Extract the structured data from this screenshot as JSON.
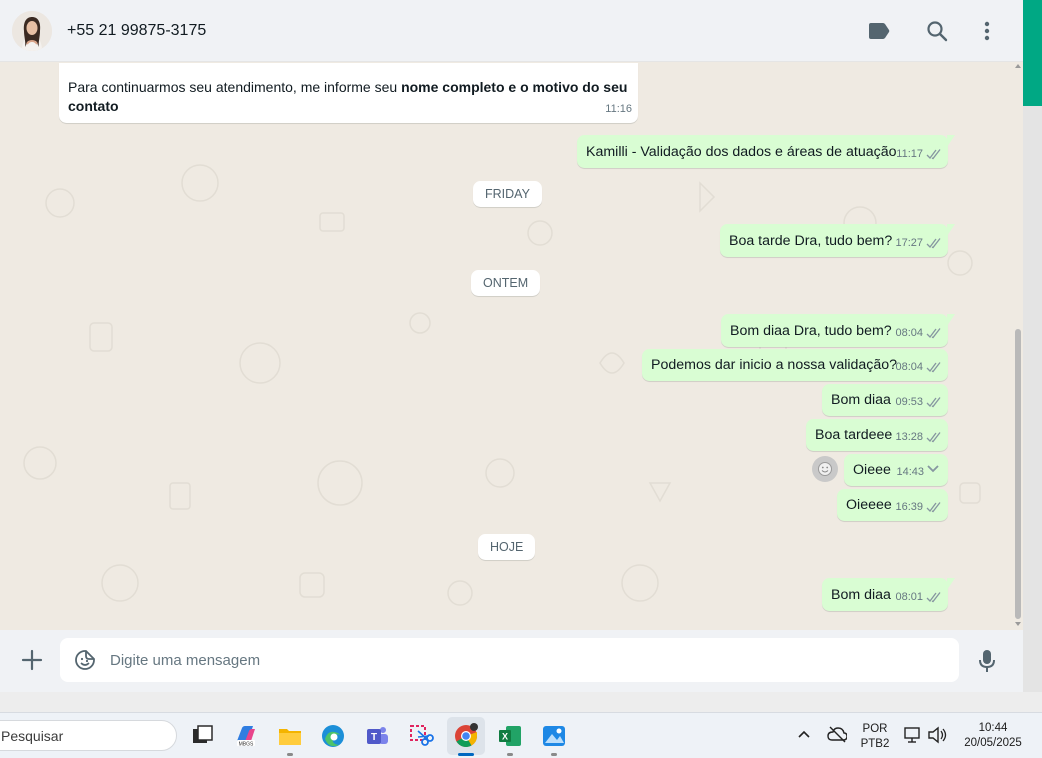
{
  "header": {
    "contact_name": "+55 21 99875-3175",
    "icons": [
      "label-icon",
      "search-icon",
      "kebab-menu-icon"
    ]
  },
  "messages": {
    "m0": {
      "text_plain": "Para continuarmos seu atendimento, me informe seu ",
      "text_bold_1": "nome completo e o motivo do seu",
      "text_bold_2": "contato",
      "time": "11:16",
      "direction": "in"
    },
    "m1": {
      "text": "Kamilli - Validação dos dados e áreas de atuação",
      "time": "11:17",
      "direction": "out"
    },
    "d1": "FRIDAY",
    "m2": {
      "text": "Boa tarde Dra, tudo bem?",
      "time": "17:27",
      "direction": "out"
    },
    "d2": "ONTEM",
    "m3": {
      "text": "Bom diaa Dra, tudo bem?",
      "time": "08:04",
      "direction": "out"
    },
    "m4": {
      "text": "Podemos dar inicio a nossa validação?",
      "time": "08:04",
      "direction": "out"
    },
    "m5": {
      "text": "Bom diaa",
      "time": "09:53",
      "direction": "out"
    },
    "m6": {
      "text": "Boa tardeee",
      "time": "13:28",
      "direction": "out"
    },
    "m7": {
      "text": "Oieee",
      "time": "14:43",
      "direction": "out"
    },
    "m8": {
      "text": "Oieeee",
      "time": "16:39",
      "direction": "out"
    },
    "d3": "HOJE",
    "m9": {
      "text": "Bom diaa",
      "time": "08:01",
      "direction": "out"
    }
  },
  "composer": {
    "placeholder": "Digite uma mensagem"
  },
  "taskbar": {
    "search_label": "Pesquisar",
    "lang_1": "POR",
    "lang_2": "PTB2",
    "clock_time": "10:44",
    "clock_date": "20/05/2025"
  },
  "colors": {
    "outgoing_bubble": "#d9fdd3",
    "incoming_bubble": "#ffffff",
    "chat_bg": "#efeae2",
    "accent": "#00a884",
    "tick_color": "#667781"
  }
}
